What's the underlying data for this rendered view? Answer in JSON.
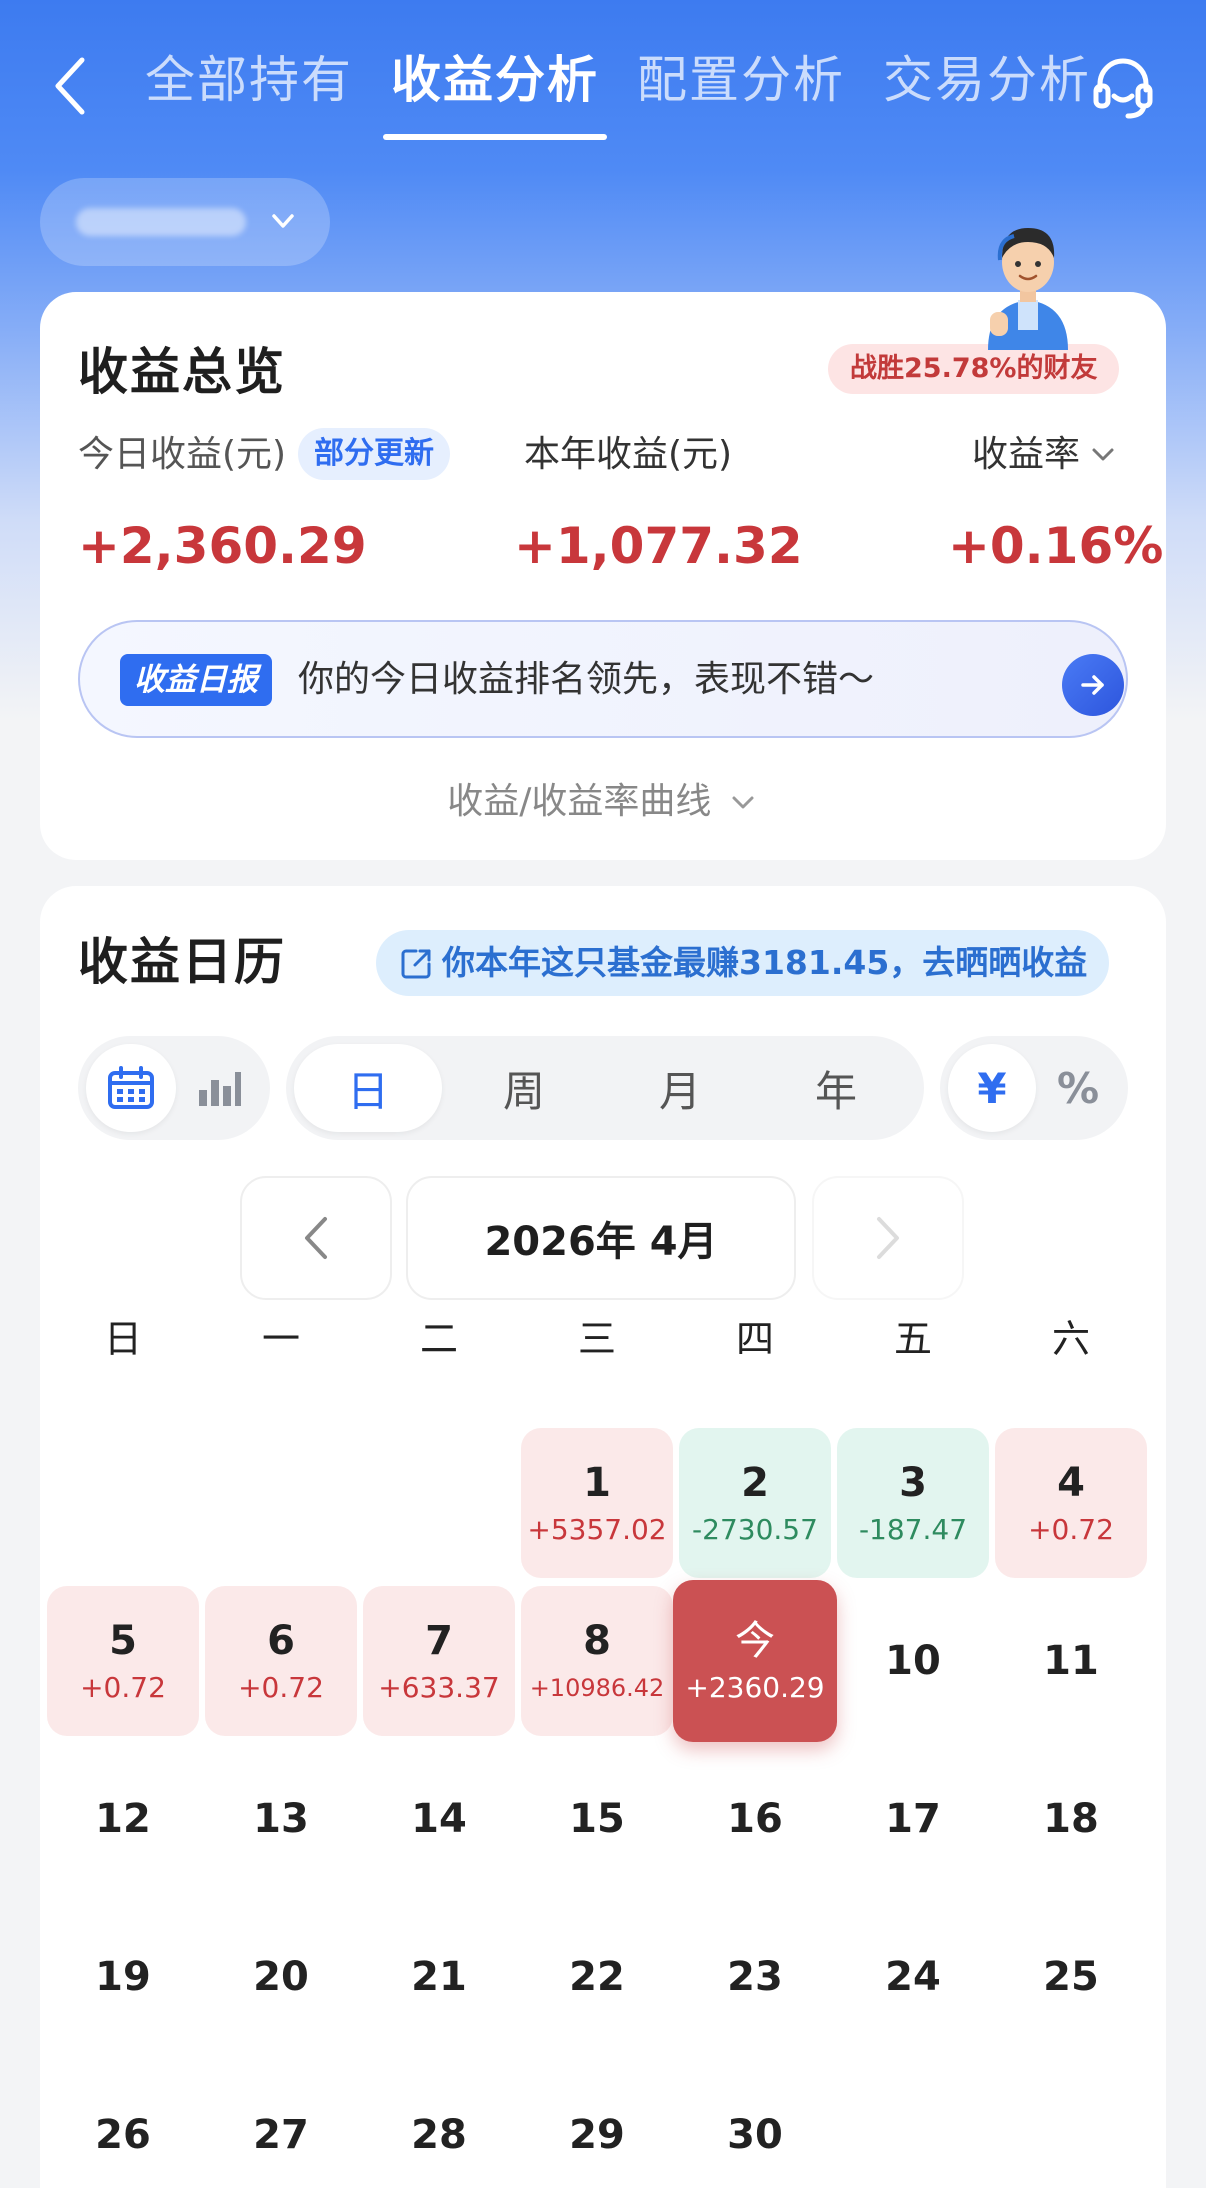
{
  "nav": {
    "tabs": [
      {
        "label": "全部持有",
        "active": false
      },
      {
        "label": "收益分析",
        "active": true
      },
      {
        "label": "配置分析",
        "active": false
      },
      {
        "label": "交易分析",
        "active": false
      }
    ],
    "back_icon": "chevron-left-icon",
    "service_icon": "headset-icon"
  },
  "overview": {
    "title": "收益总览",
    "beat_badge": "战胜25.78%的财友",
    "today_label": "今日收益(元)",
    "partial_update_tag": "部分更新",
    "year_label": "本年收益(元)",
    "rate_label": "收益率",
    "today_value": "+2,360.29",
    "year_value": "+1,077.32",
    "rate_value": "+0.16%",
    "daily_report_tag": "收益日报",
    "daily_report_text": "你的今日收益排名领先，表现不错～",
    "curve_toggle": "收益/收益率曲线"
  },
  "calendar": {
    "title": "收益日历",
    "promo": "你本年这只基金最赚3181.45，去晒晒收益",
    "view_icons": [
      "calendar-icon",
      "bar-chart-icon"
    ],
    "periods": [
      "日",
      "周",
      "月",
      "年"
    ],
    "active_period": "日",
    "units": [
      "¥",
      "%"
    ],
    "active_unit": "¥",
    "month_label": "2026年 4月",
    "weekdays": [
      "日",
      "一",
      "二",
      "三",
      "四",
      "五",
      "六"
    ],
    "days": [
      {
        "day": "1",
        "amount": "+5357.02",
        "status": "pos"
      },
      {
        "day": "2",
        "amount": "-2730.57",
        "status": "neg"
      },
      {
        "day": "3",
        "amount": "-187.47",
        "status": "neg"
      },
      {
        "day": "4",
        "amount": "+0.72",
        "status": "pos"
      },
      {
        "day": "5",
        "amount": "+0.72",
        "status": "pos"
      },
      {
        "day": "6",
        "amount": "+0.72",
        "status": "pos"
      },
      {
        "day": "7",
        "amount": "+633.37",
        "status": "pos"
      },
      {
        "day": "8",
        "amount": "+10986.42",
        "status": "pos"
      },
      {
        "day": "今",
        "amount": "+2360.29",
        "status": "today"
      },
      {
        "day": "10"
      },
      {
        "day": "11"
      },
      {
        "day": "12"
      },
      {
        "day": "13"
      },
      {
        "day": "14"
      },
      {
        "day": "15"
      },
      {
        "day": "16"
      },
      {
        "day": "17"
      },
      {
        "day": "18"
      },
      {
        "day": "19"
      },
      {
        "day": "20"
      },
      {
        "day": "21"
      },
      {
        "day": "22"
      },
      {
        "day": "23"
      },
      {
        "day": "24"
      },
      {
        "day": "25"
      },
      {
        "day": "26"
      },
      {
        "day": "27"
      },
      {
        "day": "28"
      },
      {
        "day": "29"
      },
      {
        "day": "30"
      }
    ]
  },
  "colors": {
    "primary_blue": "#2f6df0",
    "gain_red": "#c8373b",
    "loss_green": "#2e8b5f",
    "gain_bg": "#fbe9e9",
    "loss_bg": "#e2f5ef",
    "today_bg": "#cb5153"
  }
}
